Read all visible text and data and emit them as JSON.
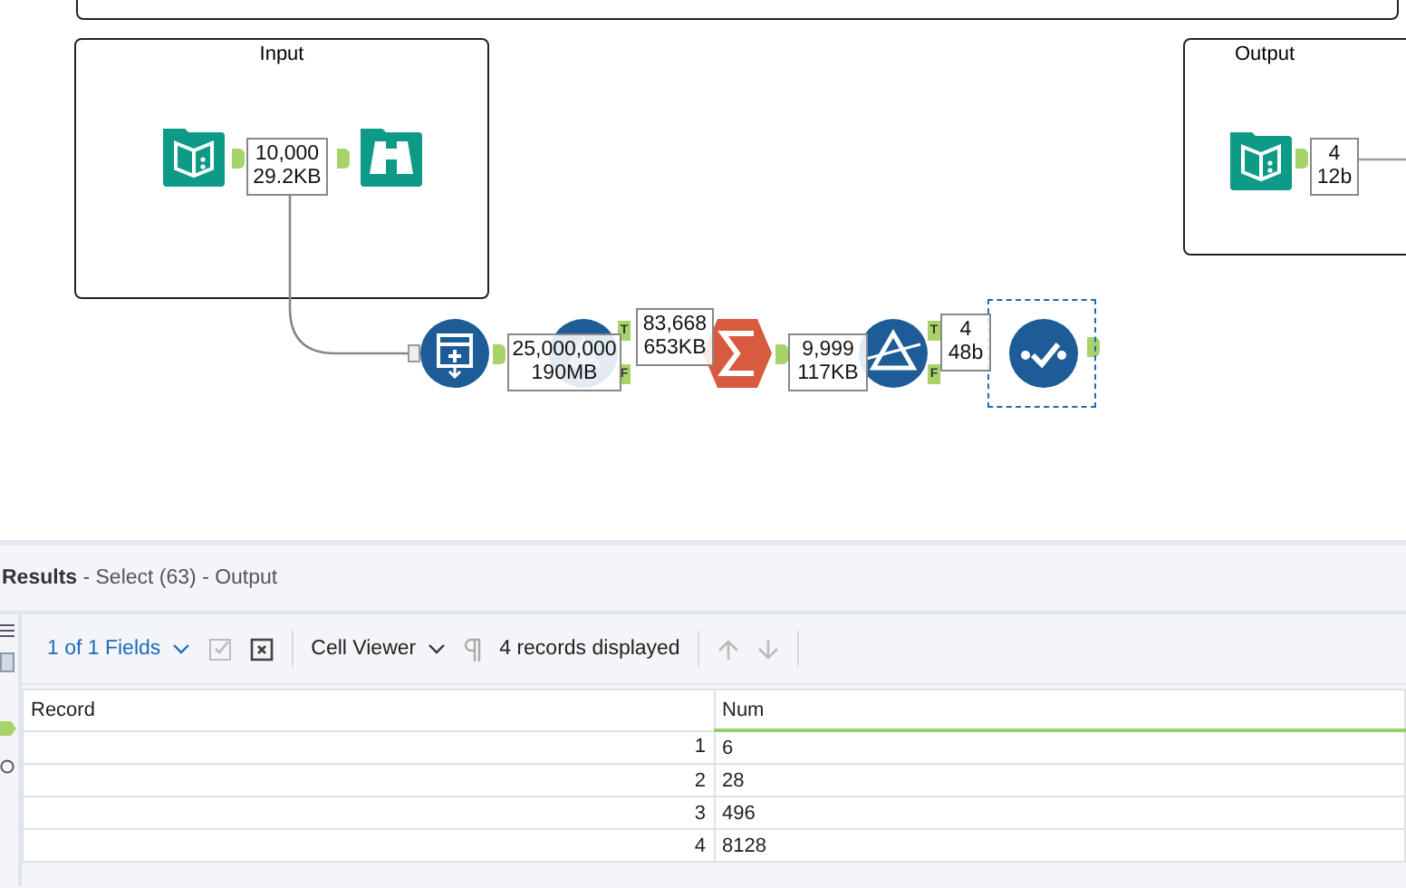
{
  "canvas": {
    "containers": [
      {
        "title": "Input"
      },
      {
        "title": "Output"
      }
    ],
    "tools": [
      {
        "kind": "book",
        "selected": false
      },
      {
        "kind": "binoculars",
        "selected": false
      },
      {
        "kind": "book",
        "selected": false
      },
      {
        "kind": "import",
        "selected": false
      },
      {
        "kind": "blank",
        "selected": false,
        "outputs": [
          "T",
          "F"
        ]
      },
      {
        "kind": "sum",
        "selected": false
      },
      {
        "kind": "prism",
        "selected": false,
        "outputs": [
          "T",
          "F"
        ]
      },
      {
        "kind": "check",
        "selected": true
      }
    ],
    "badges": [
      {
        "records": "10,000",
        "size": "29.2KB"
      },
      {
        "records": "4",
        "size": "12b"
      },
      {
        "records": "25,000,000",
        "size": "190MB"
      },
      {
        "records": "83,668",
        "size": "653KB"
      },
      {
        "records": "9,999",
        "size": "117KB"
      },
      {
        "records": "4",
        "size": "48b"
      }
    ]
  },
  "results": {
    "title": "Results",
    "subtitle": "- Select (63) - Output",
    "toolbar": {
      "fields": "1 of 1 Fields",
      "viewer": "Cell Viewer",
      "count": "4 records displayed"
    },
    "table": {
      "columns": [
        "Record",
        "Num"
      ],
      "rows": [
        [
          "1",
          "6"
        ],
        [
          "2",
          "28"
        ],
        [
          "3",
          "496"
        ],
        [
          "4",
          "8128"
        ]
      ]
    }
  }
}
